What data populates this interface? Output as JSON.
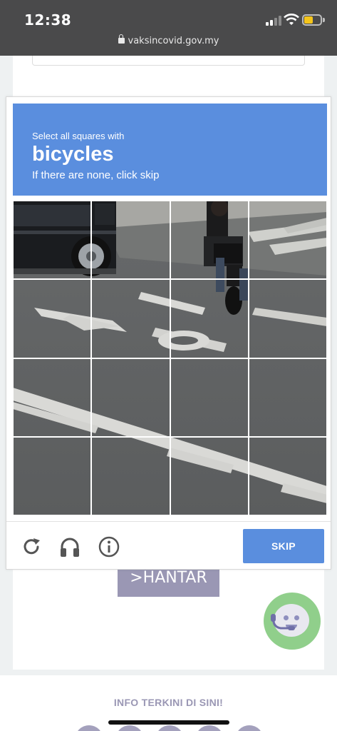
{
  "status_bar": {
    "time": "12:38",
    "url": "vaksincovid.gov.my",
    "battery_color": "#f5c51b"
  },
  "captcha": {
    "instruction_line1": "Select all squares with",
    "target_word": "bicycles",
    "instruction_line3": "If there are none, click skip",
    "skip_label": "SKIP",
    "header_color": "#5a8ede",
    "grid": {
      "rows": 4,
      "cols": 4
    },
    "tools": [
      "refresh-icon",
      "headphones-icon",
      "info-icon"
    ]
  },
  "page": {
    "submit_label": ">HANTAR",
    "footer_title": "INFO TERKINI DI SINI!",
    "chat_icon": "chatbot-icon"
  }
}
